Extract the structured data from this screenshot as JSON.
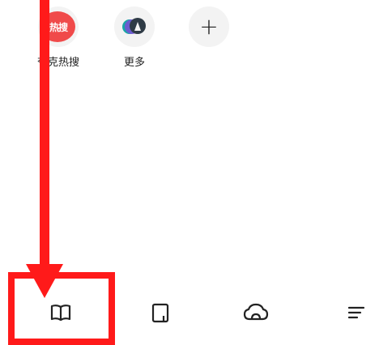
{
  "shortcuts": [
    {
      "id": "hot",
      "icon_text": "热搜",
      "label": "夸克热搜"
    },
    {
      "id": "more",
      "label": "更多"
    },
    {
      "id": "add",
      "icon_text": "+"
    }
  ],
  "tabbar": {
    "items": [
      {
        "icon": "book-icon",
        "active": true
      },
      {
        "icon": "tablet-icon"
      },
      {
        "icon": "cloud-icon"
      },
      {
        "icon": "menu-icon"
      }
    ]
  },
  "annotation": {
    "color": "#ff1a1a"
  }
}
